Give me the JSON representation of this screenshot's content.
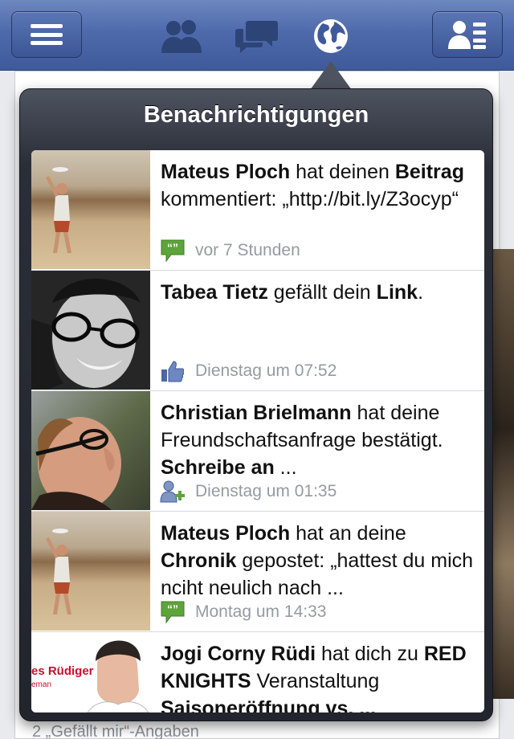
{
  "navbar": {
    "menu_icon": "hamburger-icon",
    "friends_icon": "friends-icon",
    "messages_icon": "messages-icon",
    "notifications_icon": "globe-icon",
    "profile_icon": "contact-card-icon",
    "brand_color": "#3f5a9b"
  },
  "popover": {
    "title": "Benachrichtigungen"
  },
  "notifications": [
    {
      "name": "Mateus Ploch",
      "text1": " hat deinen ",
      "bold2": "Beitrag",
      "text2": " kommentiert: „http://bit.ly/Z3ocyp“",
      "time": "vor 7 Stunden",
      "icon": "comment-icon"
    },
    {
      "name": "Tabea Tietz",
      "text1": " gefällt dein ",
      "bold2": "Link",
      "text2": ".",
      "time": "Dienstag um 07:52",
      "icon": "like-icon"
    },
    {
      "name": "Christian Brielmann",
      "text1": " hat deine Freundschaftsanfrage bestätigt. ",
      "bold2": "Schreibe an",
      "text2": " ...",
      "time": "Dienstag um 01:35",
      "icon": "friend-add-icon"
    },
    {
      "name": "Mateus Ploch",
      "text1": " hat an deine ",
      "bold2": "Chronik",
      "text2": " gepostet: „hattest du mich nciht neulich nach ...",
      "time": "Montag um 14:33",
      "icon": "comment-icon"
    },
    {
      "name": "Jogi Corny Rüdi",
      "text1": " hat dich zu ",
      "bold2": "RED KNIGHTS",
      "text2": " Veranstaltung ",
      "bold3": "Saisoneröffnung vs. ...",
      "thumb_text": "es Rüdiger",
      "thumb_subtext": "eman",
      "icon": "event-icon"
    }
  ],
  "background": {
    "footer_text": "2 „Gefällt mir“-Angaben"
  }
}
